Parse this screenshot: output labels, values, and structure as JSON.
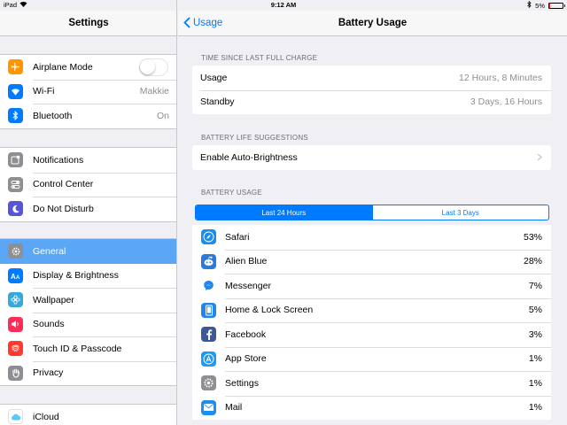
{
  "status_bar": {
    "device": "iPad",
    "time": "9:12 AM",
    "battery_percent_label": "5%",
    "battery_level": 0.05
  },
  "sidebar": {
    "title": "Settings",
    "groups": [
      {
        "items": [
          {
            "label": "Airplane Mode",
            "icon": "airplane-icon",
            "color": "#ff9500",
            "toggle": "off"
          },
          {
            "label": "Wi-Fi",
            "icon": "wifi-icon",
            "color": "#007aff",
            "value": "Makkie"
          },
          {
            "label": "Bluetooth",
            "icon": "bluetooth-icon",
            "color": "#007aff",
            "value": "On"
          }
        ]
      },
      {
        "items": [
          {
            "label": "Notifications",
            "icon": "notifications-icon",
            "color": "#8e8e93"
          },
          {
            "label": "Control Center",
            "icon": "control-center-icon",
            "color": "#8e8e93"
          },
          {
            "label": "Do Not Disturb",
            "icon": "moon-icon",
            "color": "#5856d6"
          }
        ]
      },
      {
        "items": [
          {
            "label": "General",
            "icon": "gear-icon",
            "color": "#8e8e93",
            "selected": true
          },
          {
            "label": "Display & Brightness",
            "icon": "display-icon",
            "color": "#007aff"
          },
          {
            "label": "Wallpaper",
            "icon": "wallpaper-icon",
            "color": "#34aadc"
          },
          {
            "label": "Sounds",
            "icon": "speaker-icon",
            "color": "#ff2d55"
          },
          {
            "label": "Touch ID & Passcode",
            "icon": "fingerprint-icon",
            "color": "#ff3b30"
          },
          {
            "label": "Privacy",
            "icon": "hand-icon",
            "color": "#8e8e93"
          }
        ]
      },
      {
        "items": [
          {
            "label": "iCloud",
            "icon": "cloud-icon",
            "color": "#ffffff"
          }
        ]
      }
    ]
  },
  "main": {
    "back_label": "Usage",
    "title": "Battery Usage",
    "time_since_charge": {
      "header": "TIME SINCE LAST FULL CHARGE",
      "rows": [
        {
          "label": "Usage",
          "value": "12 Hours, 8 Minutes"
        },
        {
          "label": "Standby",
          "value": "3 Days, 16 Hours"
        }
      ]
    },
    "suggestions": {
      "header": "BATTERY LIFE SUGGESTIONS",
      "item": "Enable Auto-Brightness"
    },
    "battery_usage": {
      "header": "BATTERY USAGE",
      "segments": [
        "Last 24 Hours",
        "Last 3 Days"
      ],
      "active_segment": 0,
      "apps": [
        {
          "name": "Safari",
          "percent": "53%",
          "icon": "safari-icon",
          "color": "#1a8ef0"
        },
        {
          "name": "Alien Blue",
          "percent": "28%",
          "icon": "alien-blue-icon",
          "color": "#2f7ad8"
        },
        {
          "name": "Messenger",
          "percent": "7%",
          "icon": "messenger-icon",
          "color": "#ffffff"
        },
        {
          "name": "Home & Lock Screen",
          "percent": "5%",
          "icon": "ipad-icon",
          "color": "#1e88ee"
        },
        {
          "name": "Facebook",
          "percent": "3%",
          "icon": "facebook-icon",
          "color": "#3b5998"
        },
        {
          "name": "App Store",
          "percent": "1%",
          "icon": "app-store-icon",
          "color": "#1b9af7"
        },
        {
          "name": "Settings",
          "percent": "1%",
          "icon": "gear-icon",
          "color": "#8e8e93"
        },
        {
          "name": "Mail",
          "percent": "1%",
          "icon": "mail-icon",
          "color": "#1e8ff2"
        }
      ]
    }
  }
}
